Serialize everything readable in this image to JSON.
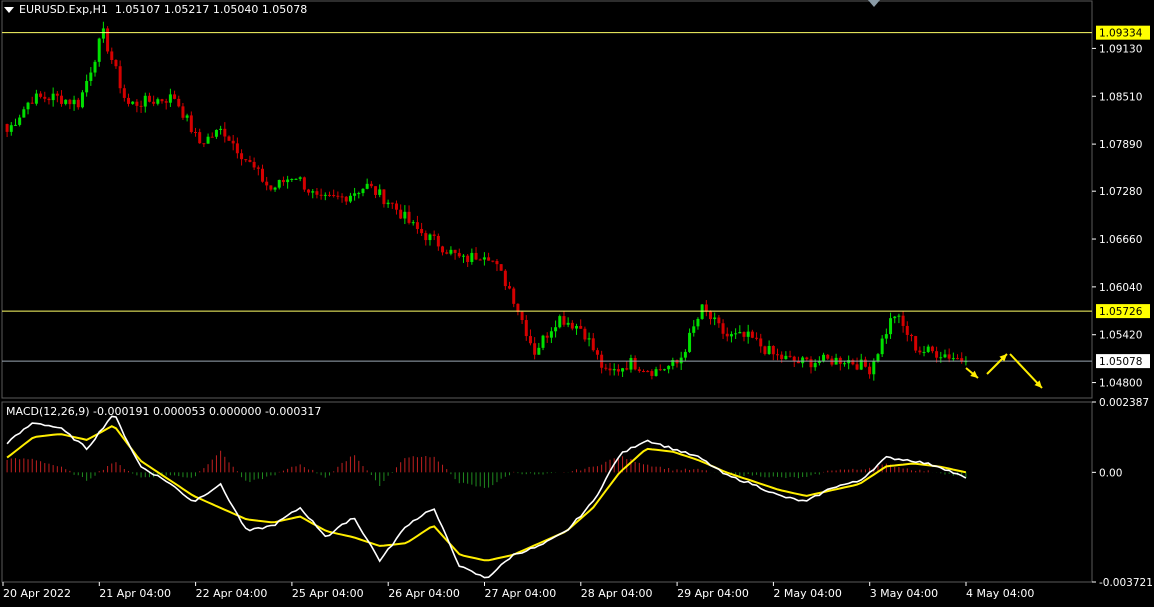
{
  "header": {
    "symbol": "EURUSD.Exp,H1",
    "ohlc": "1.05107 1.05217 1.05040 1.05078"
  },
  "macd_header": {
    "label": "MACD(12,26,9)",
    "values": "-0.000191 0.000053 0.000000 -0.000317"
  },
  "colors": {
    "background": "#000000",
    "bull_candle": "#00e000",
    "bear_candle": "#d40000",
    "grid_line": "#ffffff",
    "level_line": "#ffff66",
    "current_price_line": "#9aa6b2",
    "macd_line": "#ffffff",
    "signal_line": "#ffee00",
    "hist_pos": "#c02020",
    "hist_neg": "#1f8a1f",
    "arrow": "#ffee00"
  },
  "chart_data": [
    {
      "type": "candlestick",
      "symbol": "EURUSD.Exp",
      "timeframe": "H1",
      "y_ticks": [
        "1.09130",
        "1.08510",
        "1.07890",
        "1.07280",
        "1.06660",
        "1.06040",
        "1.05420",
        "1.04800"
      ],
      "ylim": [
        1.046,
        1.0955
      ],
      "x_ticks": [
        "20 Apr 2022",
        "21 Apr 04:00",
        "22 Apr 04:00",
        "25 Apr 04:00",
        "26 Apr 04:00",
        "27 Apr 04:00",
        "28 Apr 04:00",
        "29 Apr 04:00",
        "2 May 04:00",
        "3 May 04:00",
        "4 May 04:00"
      ],
      "price_labels": [
        {
          "name": "top-level",
          "value": "1.09334",
          "style": "yellow"
        },
        {
          "name": "resistance-level",
          "value": "1.05726",
          "style": "yellow"
        },
        {
          "name": "current-price",
          "value": "1.05078",
          "style": "white"
        }
      ],
      "levels": [
        1.09334,
        1.05726,
        1.05078
      ],
      "anchors": [
        [
          1.0812,
          1.0805
        ],
        [
          1.086,
          1.0848
        ],
        [
          1.0852,
          1.085
        ],
        [
          1.0844,
          1.0842
        ],
        [
          1.0935,
          1.0933
        ],
        [
          1.084,
          1.084
        ],
        [
          1.0838,
          1.0845
        ],
        [
          1.0852,
          1.085
        ],
        [
          1.0795,
          1.079
        ],
        [
          1.0812,
          1.0808
        ],
        [
          1.0772,
          1.0768
        ],
        [
          1.0735,
          1.073
        ],
        [
          1.0755,
          1.075
        ],
        [
          1.072,
          1.0715
        ],
        [
          1.0722,
          1.072
        ],
        [
          1.0733,
          1.0735
        ],
        [
          1.0715,
          1.0713
        ],
        [
          1.0682,
          1.068
        ],
        [
          1.0665,
          1.066
        ],
        [
          1.0642,
          1.0638
        ],
        [
          1.0645,
          1.065
        ],
        [
          1.0605,
          1.06
        ],
        [
          1.0525,
          1.052
        ],
        [
          1.0568,
          1.0565
        ],
        [
          1.0555,
          1.055
        ],
        [
          1.0495,
          1.049
        ],
        [
          1.051,
          1.0506
        ],
        [
          1.0497,
          1.0495
        ],
        [
          1.051,
          1.0505
        ],
        [
          1.057,
          1.0575
        ],
        [
          1.0545,
          1.054
        ],
        [
          1.0542,
          1.0538
        ],
        [
          1.0518,
          1.0515
        ],
        [
          1.0509,
          1.0506
        ],
        [
          1.0505,
          1.0508
        ],
        [
          1.0513,
          1.051
        ],
        [
          1.0495,
          1.0498
        ],
        [
          1.0574,
          1.057
        ],
        [
          1.0525,
          1.0522
        ],
        [
          1.052,
          1.0518
        ],
        [
          1.0512,
          1.0508
        ]
      ],
      "forecast_arrows": [
        [
          [
            966,
            368
          ],
          [
            978,
            378
          ]
        ],
        [
          [
            987,
            374
          ],
          [
            1007,
            354
          ]
        ],
        [
          [
            1010,
            354
          ],
          [
            1042,
            388
          ]
        ]
      ]
    },
    {
      "type": "line",
      "name": "MACD(12,26,9)",
      "y_ticks": [
        "0.002387",
        "0.00",
        "-0.003721"
      ],
      "ylim": [
        -0.003721,
        0.002387
      ],
      "last_values": {
        "macd": -0.000191,
        "signal": 5.3e-05,
        "osma": 0.0,
        "other": -0.000317
      },
      "macd_anchors": [
        0.001,
        0.0017,
        0.0015,
        0.0008,
        0.002,
        0.0002,
        -0.0003,
        -0.001,
        -0.0004,
        -0.002,
        -0.0018,
        -0.0012,
        -0.0022,
        -0.0015,
        -0.003,
        -0.0018,
        -0.0012,
        -0.0032,
        -0.0036,
        -0.0028,
        -0.0025,
        -0.002,
        -0.001,
        0.0006,
        0.0011,
        0.0008,
        0.0005,
        -0.0001,
        -0.0004,
        -0.0008,
        -0.001,
        -0.0005,
        -0.0003,
        0.0005,
        0.0004,
        0.0002,
        -0.0002
      ],
      "signal_anchors": [
        0.0005,
        0.0012,
        0.0013,
        0.0011,
        0.0016,
        0.0004,
        -0.0002,
        -0.0008,
        -0.0012,
        -0.0016,
        -0.0017,
        -0.0015,
        -0.002,
        -0.0022,
        -0.0025,
        -0.0024,
        -0.0018,
        -0.0028,
        -0.003,
        -0.0028,
        -0.0024,
        -0.002,
        -0.0012,
        0.0,
        0.0008,
        0.0007,
        0.0004,
        0.0,
        -0.0003,
        -0.0006,
        -0.0008,
        -0.0006,
        -0.0004,
        0.0002,
        0.0003,
        0.0002,
        0.0
      ]
    }
  ]
}
